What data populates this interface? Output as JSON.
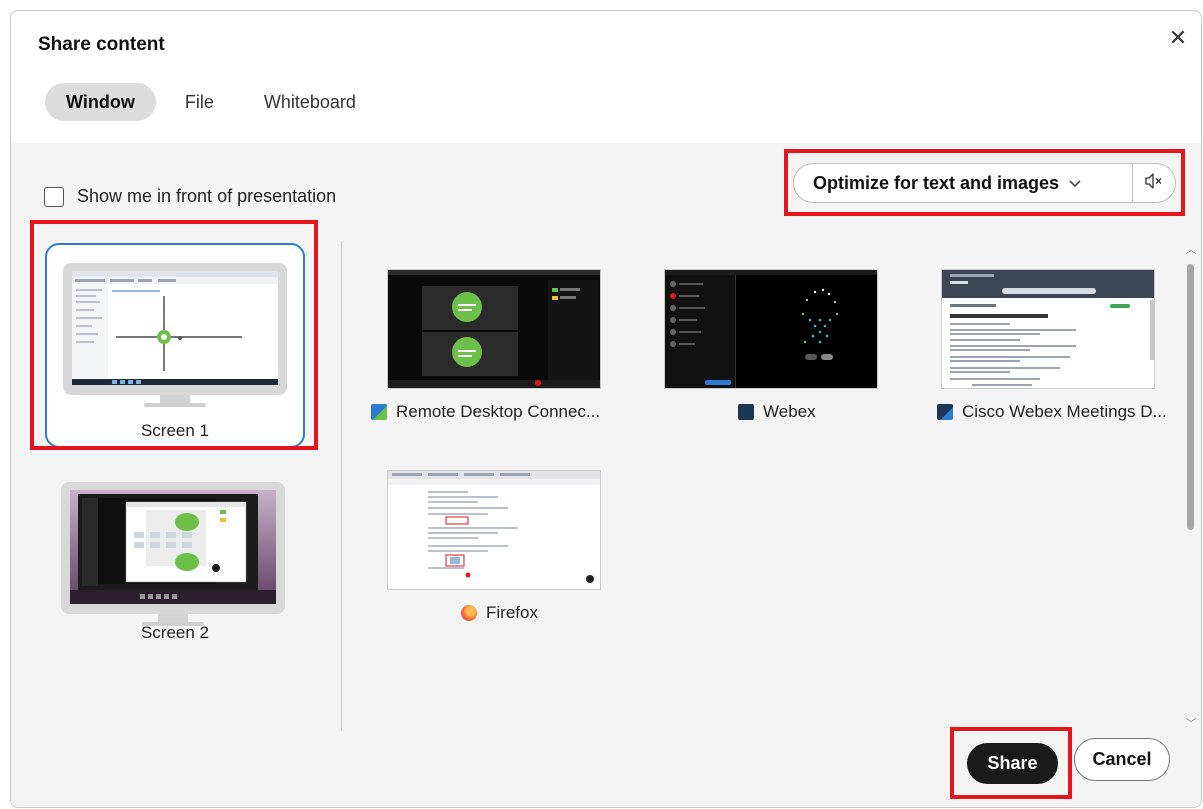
{
  "dialog": {
    "title": "Share content",
    "close_icon": "close-icon"
  },
  "tabs": [
    {
      "label": "Window",
      "active": true
    },
    {
      "label": "File",
      "active": false
    },
    {
      "label": "Whiteboard",
      "active": false
    }
  ],
  "options": {
    "show_me_label": "Show me in front of presentation",
    "show_me_checked": false,
    "optimize_label": "Optimize for text and images",
    "optimize_chevron": "chevron-down-icon",
    "audio_icon": "speaker-muted-icon"
  },
  "screens": [
    {
      "label": "Screen 1",
      "selected": true
    },
    {
      "label": "Screen 2",
      "selected": false
    }
  ],
  "windows": [
    {
      "label": "Remote Desktop Connec...",
      "icon": "remote-desktop-icon"
    },
    {
      "label": "Webex",
      "icon": "webex-icon"
    },
    {
      "label": "Cisco Webex Meetings D...",
      "icon": "webex-meetings-icon"
    },
    {
      "label": "Firefox",
      "icon": "firefox-icon"
    }
  ],
  "footer": {
    "share_label": "Share",
    "cancel_label": "Cancel"
  },
  "colors": {
    "highlight": "#e3161c",
    "selection": "#2f7fd1",
    "primary_button": "#1a1a1a"
  }
}
